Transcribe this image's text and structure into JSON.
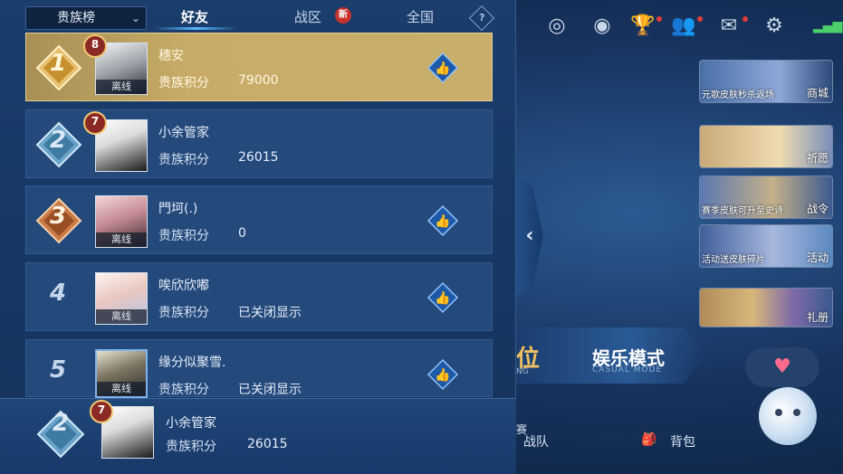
{
  "header": {
    "dropdown_label": "贵族榜",
    "tabs": [
      "好友",
      "战区",
      "全国"
    ],
    "new_badge": "新",
    "help": "?"
  },
  "rows": [
    {
      "rank": "1",
      "level": "8",
      "name": "穗安",
      "label": "贵族积分",
      "score": "79000",
      "offline": "离线"
    },
    {
      "rank": "2",
      "level": "7",
      "name": "小余管家",
      "label": "贵族积分",
      "score": "26015",
      "offline": ""
    },
    {
      "rank": "3",
      "level": "",
      "name": "門坷(.)",
      "label": "贵族积分",
      "score": "0",
      "offline": "离线"
    },
    {
      "rank": "4",
      "level": "",
      "name": "唉欣欣嘟",
      "label": "贵族积分",
      "score": "已关闭显示",
      "offline": "离线"
    },
    {
      "rank": "5",
      "level": "",
      "name": "缘分似聚雪.",
      "label": "贵族积分",
      "score": "已关闭显示",
      "offline": "离线"
    }
  ],
  "self": {
    "rank": "2",
    "level": "7",
    "name": "小余管家",
    "label": "贵族积分",
    "score": "26015"
  },
  "lobby": {
    "promos": [
      {
        "caption": "元歌皮肤秒杀返场",
        "action": "商城"
      },
      {
        "caption": "",
        "action": "祈愿"
      },
      {
        "caption": "赛季皮肤可升至史诗",
        "action": "战令"
      },
      {
        "caption": "活动送皮肤碎片",
        "action": "活动"
      },
      {
        "caption": "",
        "action": "礼册"
      }
    ],
    "mode_title": "娱乐模式",
    "mode_sub": "CASUAL MODE",
    "mode_left": "位",
    "mode_left_sub": "NG",
    "nav_team": "战队",
    "nav_bag": "背包",
    "nav_partial": "赛"
  }
}
